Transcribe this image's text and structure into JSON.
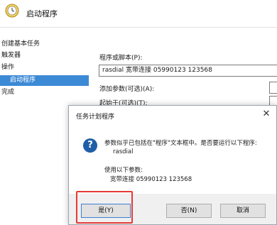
{
  "wizard": {
    "title": "启动程序",
    "steps": [
      {
        "label": "创建基本任务"
      },
      {
        "label": "触发器"
      },
      {
        "label": "操作"
      },
      {
        "label": "启动程序"
      },
      {
        "label": "完成"
      }
    ],
    "program_label": "程序或脚本(P):",
    "program_value": "rasdial 宽带连接 05990123 123568",
    "args_label": "添加参数(可选)(A):",
    "start_label": "起始于(可选)(T):"
  },
  "dialog": {
    "title": "任务计划程序",
    "close_symbol": "✕",
    "icon_symbol": "?",
    "message_line1": "参数似乎已包括在\"程序\"文本框中。是否要运行以下程序:",
    "message_line2": "rasdial",
    "message_line3": "使用以下参数:",
    "message_line4": "宽带连接 05990123 123568",
    "buttons": {
      "yes": "是(Y)",
      "no": "否(N)",
      "cancel": "取消"
    }
  },
  "colors": {
    "selection": "#3c8ad6",
    "highlight_box": "#e53935",
    "question_icon": "#1f5fa8"
  }
}
